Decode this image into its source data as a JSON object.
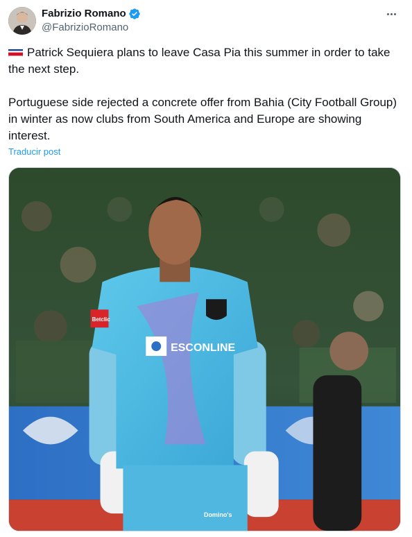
{
  "author": {
    "display_name": "Fabrizio Romano",
    "handle": "@FabrizioRomano",
    "verified": true
  },
  "post": {
    "flag_icon": "costa-rica-flag-icon",
    "paragraph_1": "Patrick Sequiera plans to leave Casa Pia this summer in order to take the next step.",
    "paragraph_2": "Portuguese side rejected a concrete offer from Bahia (City Football Group) in winter as now clubs from South America and Europe are showing interest.",
    "translate_label": "Traducir post"
  },
  "media": {
    "shirt_sponsor": "ESCONLINE",
    "shorts_sponsor": "Domino's",
    "sleeve_text": "Betclic"
  },
  "colors": {
    "link": "#1d9bf0",
    "verified": "#1d9bf0",
    "text_primary": "#0f1419",
    "text_secondary": "#536471"
  }
}
